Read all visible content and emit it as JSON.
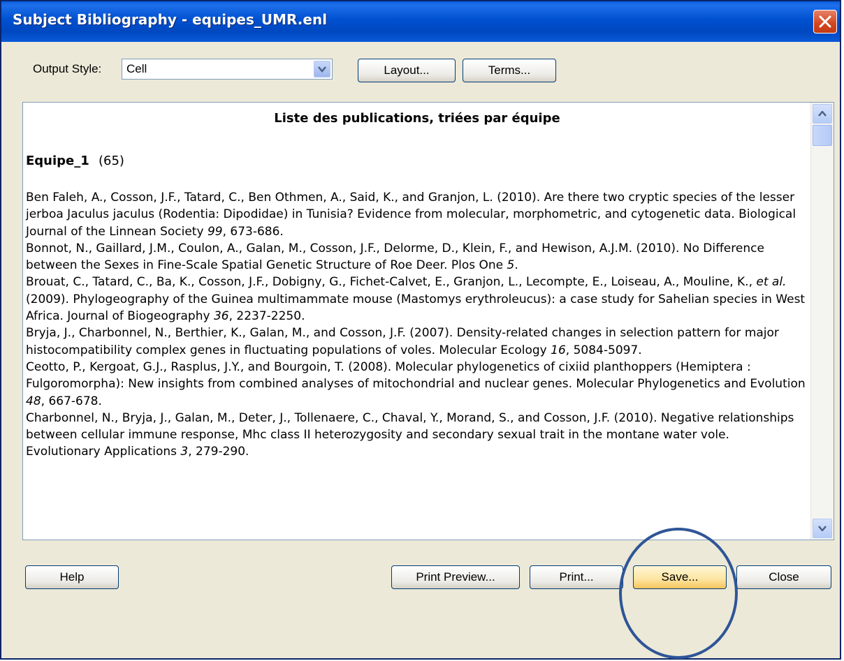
{
  "window": {
    "title": "Subject Bibliography - equipes_UMR.enl"
  },
  "output_style": {
    "label": "Output Style:",
    "value": "Cell"
  },
  "top_buttons": {
    "layout": "Layout...",
    "terms": "Terms..."
  },
  "document": {
    "title": "Liste des publications, triées par équipe",
    "group": {
      "name": "Equipe_1",
      "count": "(65)"
    },
    "references": [
      {
        "text": "Ben Faleh, A., Cosson, J.F., Tatard, C., Ben Othmen, A., Said, K., and Granjon, L. (2010). Are there two cryptic species of the lesser jerboa Jaculus jaculus (Rodentia: Dipodidae) in Tunisia? Evidence from molecular, morphometric, and cytogenetic data. Biological Journal of the Linnean Society ",
        "vol": "99",
        "tail": ", 673-686."
      },
      {
        "text": "Bonnot, N., Gaillard, J.M., Coulon, A., Galan, M., Cosson, J.F., Delorme, D., Klein, F., and Hewison, A.J.M. (2010). No Difference between the Sexes in Fine-Scale Spatial Genetic Structure of Roe Deer. Plos One ",
        "vol": "5",
        "tail": "."
      },
      {
        "text": "Brouat, C., Tatard, C., Ba, K., Cosson, J.F., Dobigny, G., Fichet-Calvet, E., Granjon, L., Lecompte, E., Loiseau, A., Mouline, K., ",
        "etal": "et al.",
        "text2": " (2009). Phylogeography of the Guinea multimammate mouse (Mastomys erythroleucus): a case study for Sahelian species in West Africa. Journal of Biogeography ",
        "vol": "36",
        "tail": ", 2237-2250."
      },
      {
        "text": "Bryja, J., Charbonnel, N., Berthier, K., Galan, M., and Cosson, J.F. (2007). Density-related changes in selection pattern for major histocompatibility complex genes in fluctuating populations of voles. Molecular Ecology ",
        "vol": "16",
        "tail": ", 5084-5097."
      },
      {
        "text": "Ceotto, P., Kergoat, G.J., Rasplus, J.Y., and Bourgoin, T. (2008). Molecular phylogenetics of cixiid planthoppers (Hemiptera : Fulgoromorpha): New insights from combined analyses of mitochondrial and nuclear genes. Molecular Phylogenetics and Evolution ",
        "vol": "48",
        "tail": ", 667-678."
      },
      {
        "text": "Charbonnel, N., Bryja, J., Galan, M., Deter, J., Tollenaere, C., Chaval, Y., Morand, S., and Cosson, J.F. (2010). Negative relationships between cellular immune response, Mhc class II heterozygosity and secondary sexual trait in the montane water vole. Evolutionary Applications ",
        "vol": "3",
        "tail": ", 279-290."
      }
    ]
  },
  "bottom_buttons": {
    "help": "Help",
    "print_preview": "Print Preview...",
    "print": "Print...",
    "save": "Save...",
    "close": "Close"
  },
  "colors": {
    "titlebar": "#0054E3",
    "dialog_bg": "#ECE9D8",
    "highlight_circle": "#2F5597"
  }
}
